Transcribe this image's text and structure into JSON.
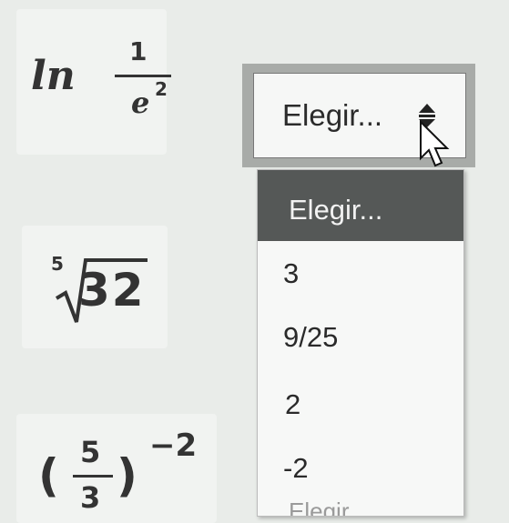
{
  "left_items": [
    {
      "expr": "ln_fraction",
      "func": "ln",
      "numerator": "1",
      "denominator_base": "e",
      "denominator_exp": "2"
    },
    {
      "expr": "nth_root",
      "index": "5",
      "radicand": "32"
    },
    {
      "expr": "power_fraction",
      "numerator": "5",
      "denominator": "3",
      "exponent": "−2"
    }
  ],
  "select": {
    "label": "Elegir...",
    "options": [
      "Elegir...",
      "3",
      "9/25",
      "2",
      "-2"
    ],
    "partially_visible_next": "Elegir..."
  },
  "colors": {
    "page_bg": "#e9ece9",
    "selected_option_bg": "#555857",
    "select_frame": "#a8aba8"
  }
}
